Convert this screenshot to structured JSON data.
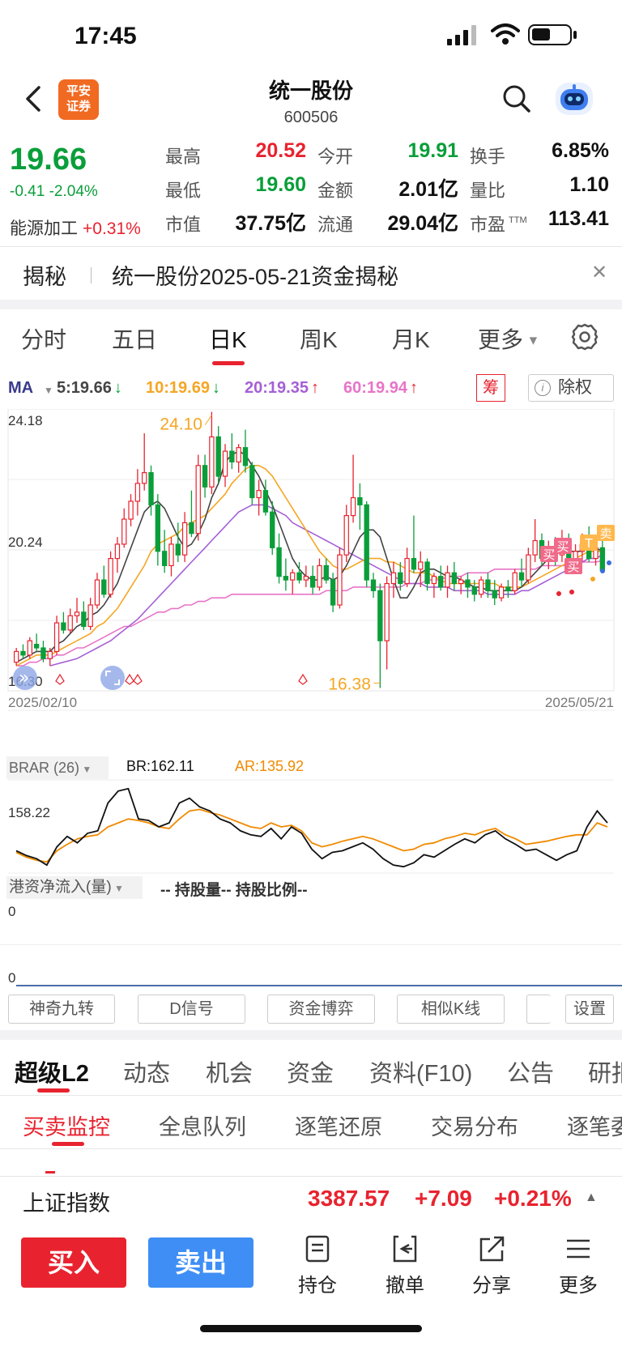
{
  "status": {
    "time": "17:45"
  },
  "header": {
    "logo_text": "平安证券",
    "title": "统一股份",
    "code": "600506"
  },
  "quote": {
    "price": "19.66",
    "change": "-0.41 -2.04%",
    "sector_name": "能源加工",
    "sector_change": "+0.31%",
    "fields": [
      {
        "label": "最高",
        "value": "20.52",
        "color": "#e8232f"
      },
      {
        "label": "今开",
        "value": "19.91",
        "color": "#0a9e3a"
      },
      {
        "label": "换手",
        "value": "6.85%",
        "color": "#111111"
      },
      {
        "label": "最低",
        "value": "19.60",
        "color": "#0a9e3a"
      },
      {
        "label": "金额",
        "value": "2.01亿",
        "color": "#111111"
      },
      {
        "label": "量比",
        "value": "1.10",
        "color": "#111111"
      },
      {
        "label": "市值",
        "value": "37.75亿",
        "color": "#111111"
      },
      {
        "label": "流通",
        "value": "29.04亿",
        "color": "#111111"
      },
      {
        "label": "市盈",
        "value": "113.41",
        "color": "#111111",
        "sup": "TTM"
      }
    ]
  },
  "reveal": {
    "tag": "揭秘",
    "text": "统一股份2025-05-21资金揭秘"
  },
  "period_tabs": [
    "分时",
    "五日",
    "日K",
    "周K",
    "月K",
    "更多"
  ],
  "active_period": "日K",
  "ma_legend": {
    "label": "MA",
    "items": [
      {
        "text": "5:19.66",
        "arrow": "↓",
        "color": "#444444"
      },
      {
        "text": "10:19.69",
        "arrow": "↓",
        "color": "#f5a623"
      },
      {
        "text": "20:19.35",
        "arrow": "↑",
        "color": "#a55fd6"
      },
      {
        "text": "60:19.94",
        "arrow": "↑",
        "color": "#e874c8"
      }
    ],
    "chip_button": "筹",
    "exright_button": "除权"
  },
  "chart_data": {
    "type": "candlestick",
    "y_axis_labels": [
      "24.18",
      "20.24",
      "16.30"
    ],
    "ylim": [
      16.3,
      24.18
    ],
    "high_annotation": "24.10",
    "low_annotation": "16.38",
    "start_date": "2025/02/10",
    "end_date": "2025/05/21",
    "trade_markers": [
      "买",
      "买",
      "买",
      "T",
      "卖"
    ],
    "candles": [
      [
        17.1,
        17.5,
        17.0,
        17.4
      ],
      [
        17.4,
        17.6,
        17.2,
        17.3
      ],
      [
        17.3,
        17.8,
        17.2,
        17.7
      ],
      [
        17.6,
        17.9,
        17.4,
        17.5
      ],
      [
        17.5,
        17.7,
        17.1,
        17.2
      ],
      [
        17.2,
        17.5,
        17.0,
        17.4
      ],
      [
        17.4,
        18.4,
        17.3,
        18.2
      ],
      [
        18.2,
        18.5,
        17.9,
        18.0
      ],
      [
        18.0,
        18.6,
        17.9,
        18.4
      ],
      [
        18.4,
        18.9,
        18.2,
        18.5
      ],
      [
        18.5,
        18.8,
        18.0,
        18.1
      ],
      [
        18.1,
        18.9,
        18.0,
        18.7
      ],
      [
        18.7,
        19.6,
        18.6,
        19.4
      ],
      [
        19.4,
        19.8,
        18.9,
        19.0
      ],
      [
        19.0,
        20.2,
        18.9,
        20.0
      ],
      [
        20.0,
        20.6,
        19.6,
        20.4
      ],
      [
        20.4,
        21.4,
        20.3,
        21.1
      ],
      [
        21.1,
        21.8,
        20.9,
        21.6
      ],
      [
        21.6,
        22.5,
        21.2,
        22.1
      ],
      [
        22.1,
        23.5,
        21.9,
        22.4
      ],
      [
        22.4,
        22.6,
        21.2,
        21.5
      ],
      [
        21.5,
        21.8,
        19.8,
        20.2
      ],
      [
        20.2,
        20.8,
        19.6,
        19.8
      ],
      [
        19.8,
        20.6,
        19.5,
        20.4
      ],
      [
        20.4,
        21.0,
        19.9,
        20.1
      ],
      [
        20.1,
        21.3,
        19.9,
        21.0
      ],
      [
        21.0,
        21.9,
        20.6,
        20.7
      ],
      [
        20.7,
        22.9,
        20.5,
        22.6
      ],
      [
        22.6,
        22.9,
        21.7,
        22.0
      ],
      [
        22.0,
        24.1,
        21.8,
        23.4
      ],
      [
        23.4,
        23.7,
        22.1,
        22.3
      ],
      [
        22.3,
        23.2,
        22.0,
        23.0
      ],
      [
        23.0,
        23.5,
        22.5,
        22.7
      ],
      [
        22.7,
        23.2,
        22.4,
        23.1
      ],
      [
        23.1,
        23.6,
        22.4,
        22.6
      ],
      [
        22.6,
        22.7,
        21.5,
        21.7
      ],
      [
        21.7,
        22.2,
        21.2,
        21.9
      ],
      [
        21.9,
        22.2,
        21.2,
        21.3
      ],
      [
        21.3,
        21.6,
        20.1,
        20.3
      ],
      [
        20.3,
        20.7,
        19.3,
        19.5
      ],
      [
        19.5,
        20.0,
        19.1,
        19.4
      ],
      [
        19.4,
        19.7,
        19.0,
        19.6
      ],
      [
        19.6,
        19.9,
        19.3,
        19.4
      ],
      [
        19.4,
        19.8,
        19.2,
        19.5
      ],
      [
        19.5,
        19.8,
        19.0,
        19.2
      ],
      [
        19.2,
        20.0,
        19.1,
        19.8
      ],
      [
        19.8,
        20.0,
        19.3,
        19.4
      ],
      [
        19.4,
        19.6,
        18.5,
        18.7
      ],
      [
        18.7,
        20.3,
        18.6,
        20.1
      ],
      [
        20.1,
        21.5,
        19.9,
        21.2
      ],
      [
        21.2,
        22.9,
        21.0,
        21.7
      ],
      [
        21.7,
        22.1,
        20.8,
        21.5
      ],
      [
        21.5,
        21.6,
        19.2,
        19.4
      ],
      [
        19.4,
        19.6,
        18.9,
        19.1
      ],
      [
        19.1,
        19.3,
        16.38,
        17.7
      ],
      [
        17.7,
        19.5,
        16.9,
        19.3
      ],
      [
        19.3,
        19.9,
        18.9,
        19.6
      ],
      [
        19.6,
        19.9,
        19.1,
        19.3
      ],
      [
        19.3,
        20.3,
        19.2,
        20.0
      ],
      [
        20.0,
        21.2,
        19.6,
        19.7
      ],
      [
        19.7,
        20.2,
        19.2,
        19.9
      ],
      [
        19.9,
        20.0,
        19.1,
        19.3
      ],
      [
        19.3,
        19.6,
        18.9,
        19.5
      ],
      [
        19.5,
        19.8,
        19.1,
        19.2
      ],
      [
        19.2,
        19.8,
        18.9,
        19.6
      ],
      [
        19.6,
        19.9,
        19.1,
        19.3
      ],
      [
        19.3,
        19.5,
        19.0,
        19.4
      ],
      [
        19.4,
        19.6,
        18.9,
        19.2
      ],
      [
        19.2,
        19.4,
        18.8,
        19.0
      ],
      [
        19.0,
        19.5,
        18.9,
        19.4
      ],
      [
        19.4,
        19.6,
        18.9,
        19.1
      ],
      [
        19.1,
        19.4,
        18.7,
        18.9
      ],
      [
        18.9,
        19.3,
        18.8,
        19.2
      ],
      [
        19.2,
        19.4,
        18.9,
        19.1
      ],
      [
        19.1,
        19.7,
        19.0,
        19.6
      ],
      [
        19.6,
        20.0,
        19.2,
        19.4
      ],
      [
        19.4,
        20.3,
        19.3,
        20.1
      ],
      [
        20.1,
        21.1,
        19.9,
        20.5
      ],
      [
        20.5,
        20.7,
        19.8,
        20.0
      ],
      [
        20.0,
        20.5,
        19.7,
        20.3
      ],
      [
        20.3,
        20.6,
        19.8,
        20.1
      ],
      [
        20.1,
        20.8,
        19.9,
        20.5
      ],
      [
        20.5,
        20.7,
        19.8,
        20.0
      ],
      [
        20.0,
        20.4,
        19.7,
        20.2
      ],
      [
        20.2,
        20.7,
        19.9,
        20.4
      ],
      [
        20.4,
        20.9,
        19.9,
        20.0
      ],
      [
        20.0,
        20.6,
        19.8,
        20.3
      ],
      [
        20.3,
        20.52,
        19.6,
        19.66
      ]
    ],
    "ma5": [
      17.1,
      17.2,
      17.3,
      17.4,
      17.4,
      17.4,
      17.6,
      17.7,
      17.9,
      18.1,
      18.2,
      18.4,
      18.5,
      18.7,
      19.0,
      19.3,
      19.8,
      20.3,
      20.8,
      21.3,
      21.5,
      21.6,
      21.4,
      21.0,
      20.6,
      20.3,
      20.4,
      20.7,
      21.1,
      21.7,
      22.1,
      22.7,
      22.9,
      23.0,
      22.9,
      22.6,
      22.3,
      21.9,
      21.5,
      21.0,
      20.5,
      20.0,
      19.7,
      19.5,
      19.4,
      19.4,
      19.5,
      19.4,
      19.5,
      19.8,
      20.2,
      20.6,
      20.8,
      20.8,
      20.6,
      20.0,
      19.4,
      18.9,
      18.9,
      19.2,
      19.6,
      19.7,
      19.7,
      19.6,
      19.5,
      19.5,
      19.4,
      19.3,
      19.2,
      19.2,
      19.1,
      19.1,
      19.1,
      19.1,
      19.1,
      19.2,
      19.4,
      19.6,
      19.8,
      20.0,
      20.2,
      20.3,
      20.2,
      20.2,
      20.2,
      20.3,
      20.3,
      20.2
    ],
    "ma10": [
      17.0,
      17.1,
      17.2,
      17.3,
      17.3,
      17.3,
      17.4,
      17.5,
      17.6,
      17.7,
      17.8,
      17.9,
      18.1,
      18.2,
      18.4,
      18.6,
      18.9,
      19.2,
      19.5,
      19.8,
      20.2,
      20.4,
      20.5,
      20.6,
      20.7,
      20.9,
      21.0,
      21.1,
      21.2,
      21.4,
      21.6,
      21.8,
      22.1,
      22.3,
      22.5,
      22.6,
      22.6,
      22.5,
      22.3,
      22.0,
      21.7,
      21.4,
      21.1,
      20.8,
      20.5,
      20.2,
      20.0,
      19.8,
      19.7,
      19.7,
      19.8,
      19.9,
      20.0,
      20.0,
      20.0,
      19.9,
      19.9,
      19.8,
      19.7,
      19.6,
      19.6,
      19.6,
      19.5,
      19.4,
      19.3,
      19.3,
      19.3,
      19.3,
      19.3,
      19.3,
      19.3,
      19.3,
      19.2,
      19.2,
      19.2,
      19.2,
      19.3,
      19.4,
      19.5,
      19.6,
      19.7,
      19.8,
      19.9,
      20.0,
      20.1,
      20.2,
      20.2,
      20.2
    ],
    "ma20": [
      null,
      null,
      null,
      null,
      null,
      17.0,
      17.05,
      17.1,
      17.15,
      17.2,
      17.3,
      17.4,
      17.5,
      17.6,
      17.7,
      17.85,
      18.0,
      18.15,
      18.3,
      18.5,
      18.7,
      18.9,
      19.1,
      19.3,
      19.5,
      19.7,
      19.9,
      20.1,
      20.3,
      20.5,
      20.7,
      20.9,
      21.1,
      21.3,
      21.4,
      21.5,
      21.5,
      21.5,
      21.4,
      21.3,
      21.2,
      21.0,
      20.9,
      20.8,
      20.7,
      20.6,
      20.5,
      20.4,
      20.3,
      20.2,
      20.1,
      20.0,
      19.9,
      19.8,
      19.7,
      19.6,
      19.5,
      19.4,
      19.3,
      19.3,
      19.3,
      19.2,
      19.2,
      19.2,
      19.2,
      19.1,
      19.1,
      19.1,
      19.1,
      19.1,
      19.0,
      19.0,
      19.0,
      19.0,
      19.0,
      19.1,
      19.1,
      19.2,
      19.3,
      19.4,
      19.5,
      19.6,
      19.7,
      19.8,
      19.9,
      20.0,
      20.0,
      20.1
    ],
    "ma60": [
      17.0,
      17.0,
      17.1,
      17.1,
      17.2,
      17.2,
      17.3,
      17.3,
      17.4,
      17.5,
      17.5,
      17.6,
      17.7,
      17.8,
      17.9,
      18.0,
      18.1,
      18.1,
      18.2,
      18.3,
      18.4,
      18.5,
      18.5,
      18.6,
      18.6,
      18.7,
      18.7,
      18.8,
      18.8,
      18.9,
      18.9,
      18.9,
      19.0,
      19.0,
      19.0,
      19.0,
      19.0,
      19.0,
      19.0,
      19.0,
      19.0,
      19.0,
      19.0,
      19.0,
      19.0,
      19.0,
      19.1,
      19.1,
      19.1,
      19.1,
      19.2,
      19.2,
      19.2,
      19.2,
      19.2,
      19.2,
      19.2,
      19.2,
      19.3,
      19.3,
      19.3,
      19.4,
      19.4,
      19.4,
      19.5,
      19.5,
      19.5,
      19.6,
      19.6,
      19.6,
      19.6,
      19.7,
      19.7,
      19.7,
      19.7,
      19.7,
      19.7,
      19.7,
      19.8,
      19.8,
      19.8,
      19.8,
      19.8,
      19.9,
      19.9,
      19.9,
      19.9,
      19.94
    ]
  },
  "indicator": {
    "selector": "BRAR (26)",
    "br_text": "BR:162.11",
    "ar_text": "AR:135.92",
    "axis_label": "158.22",
    "br": [
      110,
      104,
      100,
      92,
      115,
      128,
      120,
      132,
      135,
      170,
      185,
      188,
      150,
      148,
      140,
      145,
      170,
      176,
      165,
      160,
      150,
      145,
      135,
      130,
      128,
      138,
      125,
      140,
      132,
      112,
      100,
      108,
      110,
      115,
      120,
      112,
      100,
      92,
      90,
      95,
      105,
      102,
      110,
      118,
      125,
      120,
      130,
      135,
      125,
      118,
      110,
      112,
      105,
      98,
      105,
      110,
      140,
      160,
      145
    ],
    "ar": [
      108,
      102,
      98,
      96,
      110,
      118,
      125,
      128,
      130,
      140,
      145,
      150,
      148,
      145,
      140,
      138,
      150,
      160,
      162,
      158,
      155,
      150,
      145,
      140,
      138,
      145,
      140,
      142,
      135,
      120,
      115,
      118,
      122,
      125,
      128,
      125,
      120,
      115,
      110,
      112,
      118,
      120,
      125,
      128,
      132,
      130,
      135,
      138,
      130,
      125,
      118,
      120,
      122,
      125,
      128,
      130,
      130,
      145,
      140
    ]
  },
  "hk_flow": {
    "selector": "港资净流入(量)",
    "summary": "--   持股量--   持股比例--",
    "axis_top": "0",
    "axis_bottom": "0"
  },
  "tools": [
    "神奇九转",
    "D信号",
    "资金博弈",
    "相似K线",
    "设置"
  ],
  "l2_tabs": [
    "超级L2",
    "动态",
    "机会",
    "资金",
    "资料(F10)",
    "公告",
    "研报"
  ],
  "sub_tabs": [
    "买卖监控",
    "全息队列",
    "逐笔还原",
    "交易分布",
    "逐笔委托"
  ],
  "index": {
    "name": "上证指数",
    "value": "3387.57",
    "change": "+7.09",
    "pct": "+0.21%"
  },
  "bottom": {
    "buy": "买入",
    "sell": "卖出",
    "items": [
      "持仓",
      "撤单",
      "分享",
      "更多"
    ]
  }
}
